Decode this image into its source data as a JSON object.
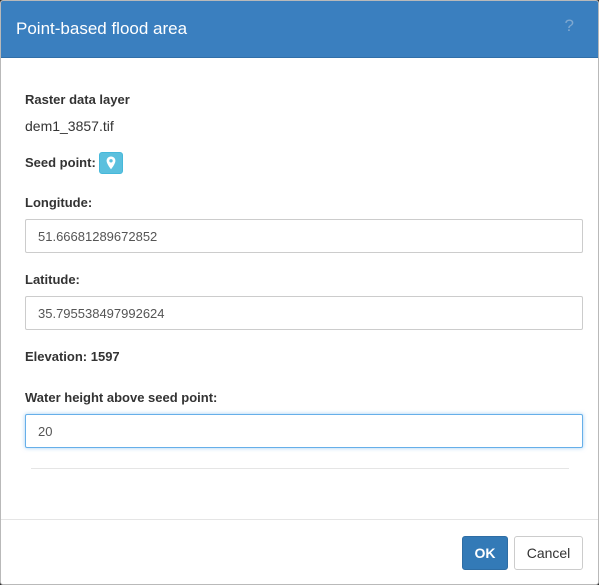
{
  "dialog": {
    "title": "Point-based flood area",
    "help_symbol": "?"
  },
  "raster": {
    "label": "Raster data layer",
    "value": "dem1_3857.tif"
  },
  "seed_point": {
    "label": "Seed point:",
    "button_icon": "map-marker-icon",
    "button_color": "#5bc0de"
  },
  "longitude": {
    "label": "Longitude:",
    "value": "51.66681289672852"
  },
  "latitude": {
    "label": "Latitude:",
    "value": "35.795538497992624"
  },
  "elevation": {
    "label": "Elevation: 1597"
  },
  "water_height": {
    "label": "Water height above seed point:",
    "value": "20"
  },
  "footer": {
    "ok_label": "OK",
    "cancel_label": "Cancel"
  },
  "colors": {
    "header_bg": "#3a7fbf",
    "primary": "#337ab7",
    "focus_border": "#66afe9"
  }
}
